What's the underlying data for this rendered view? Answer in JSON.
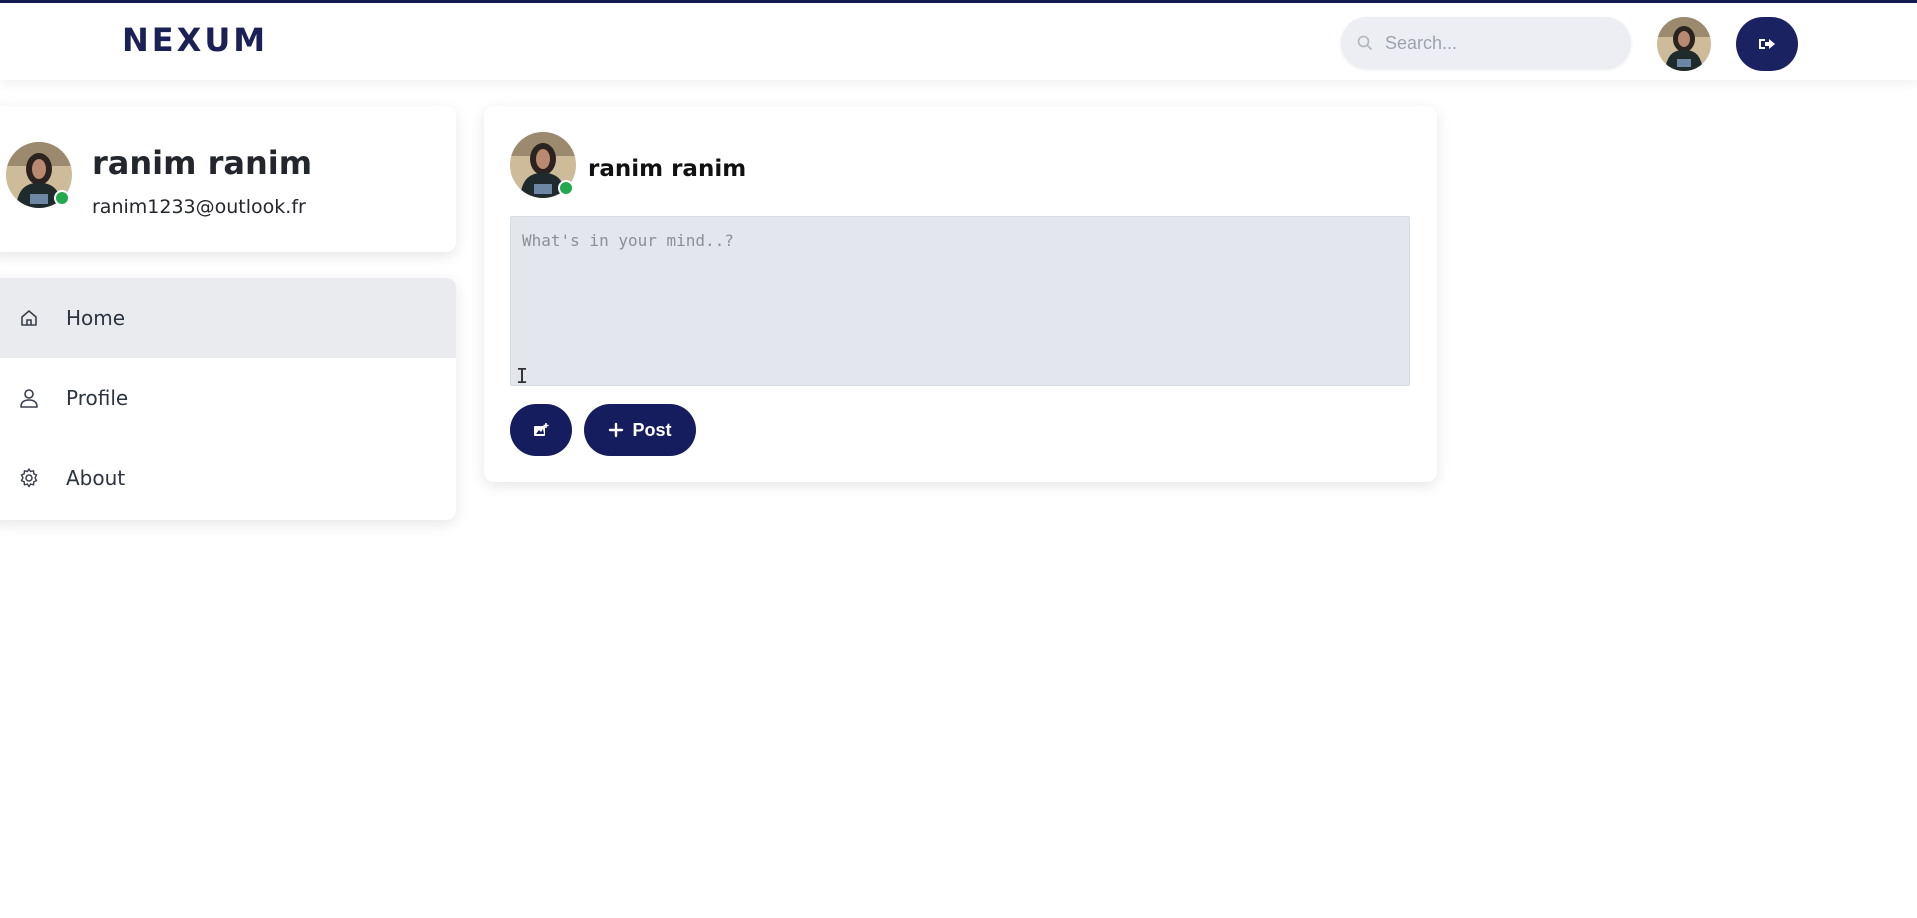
{
  "app": {
    "logo": "NEXUM"
  },
  "header": {
    "search_placeholder": "Search...",
    "search_icon": "search-icon",
    "avatar_icon": "user-avatar",
    "logout_icon": "logout-icon"
  },
  "profile": {
    "name": "ranim ranim",
    "email": "ranim1233@outlook.fr",
    "online": true
  },
  "sidebar": {
    "items": [
      {
        "label": "Home",
        "icon": "home-icon",
        "active": true
      },
      {
        "label": "Profile",
        "icon": "user-icon",
        "active": false
      },
      {
        "label": "About",
        "icon": "gear-icon",
        "active": false
      }
    ]
  },
  "composer": {
    "author": "ranim ranim",
    "placeholder": "What's in your mind..?",
    "image_icon": "image-add-icon",
    "post_label": "Post",
    "post_icon": "plus-icon"
  },
  "colors": {
    "primary": "#161d5e",
    "online": "#22a94f",
    "active_nav": "#eaebef"
  }
}
